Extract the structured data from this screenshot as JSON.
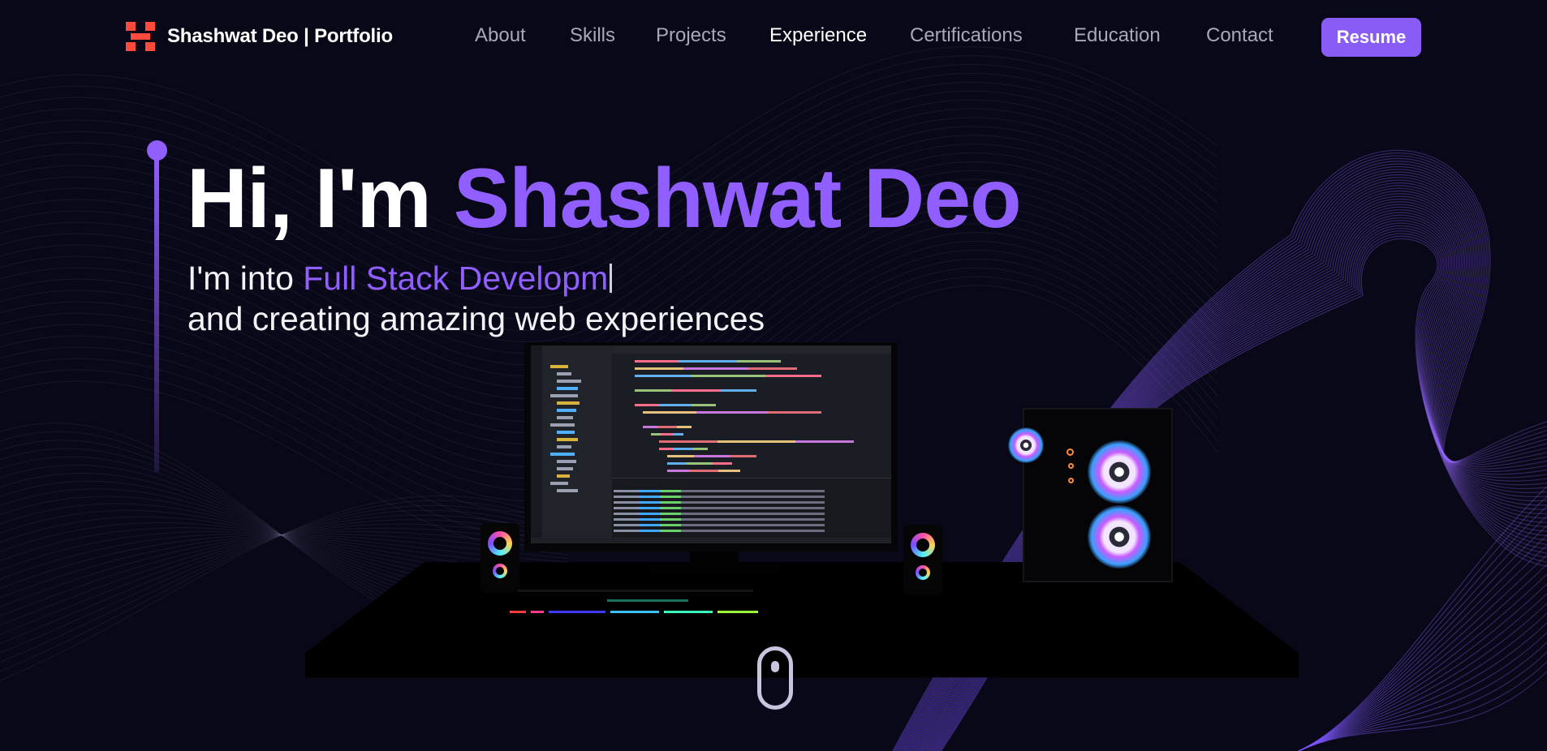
{
  "nav": {
    "logo_text": "Shashwat Deo | Portfolio",
    "logo_icon": "logo-mark-icon",
    "links": [
      {
        "label": "About",
        "active": false
      },
      {
        "label": "Skills",
        "active": false
      },
      {
        "label": "Projects",
        "active": false
      },
      {
        "label": "Experience",
        "active": true
      },
      {
        "label": "Certifications",
        "active": false
      },
      {
        "label": "Education",
        "active": false
      },
      {
        "label": "Contact",
        "active": false
      }
    ],
    "resume_label": "Resume"
  },
  "hero": {
    "greeting": "Hi, I'm ",
    "name": "Shashwat Deo",
    "intro_prefix": "I'm into ",
    "typed_text": "Full Stack Developm",
    "tagline": "and creating amazing web experiences"
  },
  "colors": {
    "background": "#080818",
    "accent": "#915eff",
    "resume_button": "#8a5cf6",
    "logo": "#ff4b3e"
  }
}
